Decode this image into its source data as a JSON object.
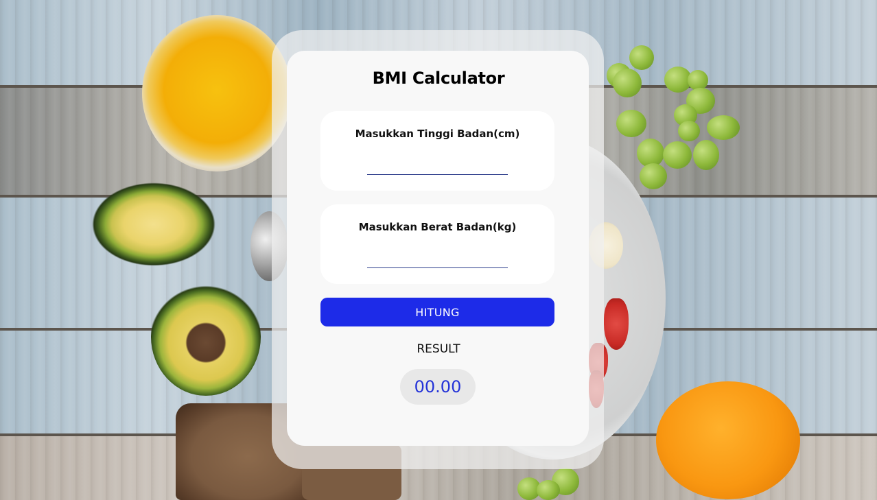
{
  "app": {
    "title": "BMI Calculator"
  },
  "form": {
    "height": {
      "label": "Masukkan Tinggi Badan(cm)",
      "value": "",
      "placeholder": ""
    },
    "weight": {
      "label": "Masukkan Berat Badan(kg)",
      "value": "",
      "placeholder": ""
    },
    "submit_label": "HITUNG"
  },
  "result": {
    "label": "RESULT",
    "value": "00.00"
  },
  "colors": {
    "button": "#1d2be8",
    "result_text": "#2433d8",
    "card": "#f8f8f8"
  }
}
